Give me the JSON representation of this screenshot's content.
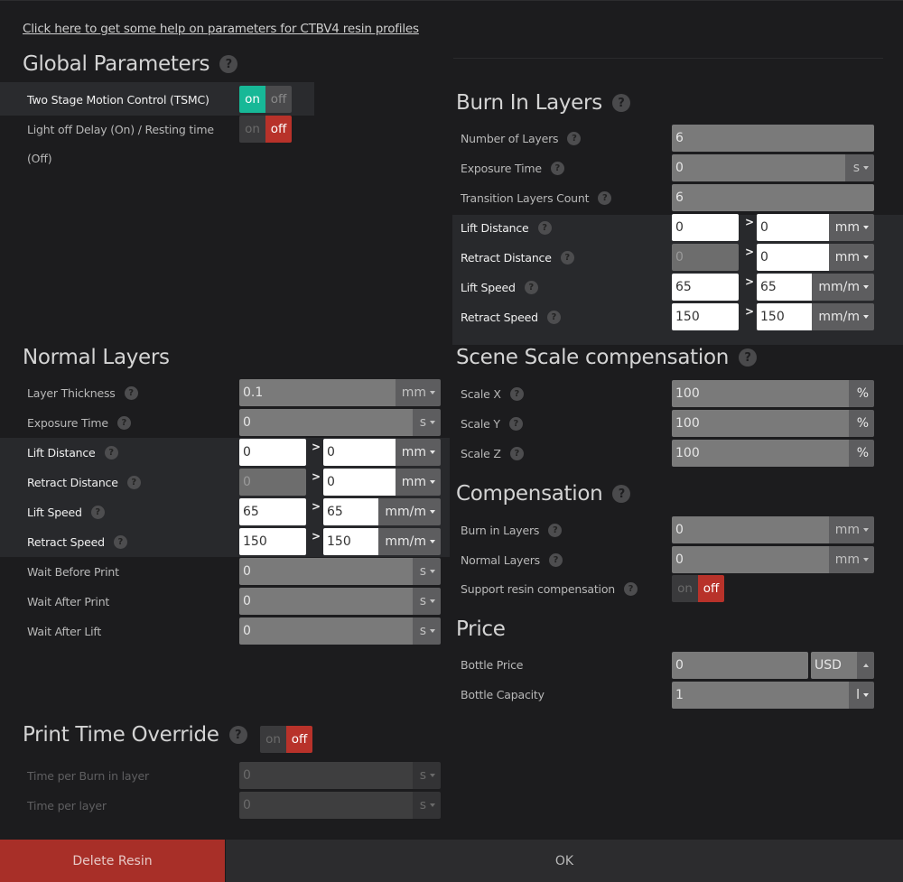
{
  "help_link": "Click here to get some help on parameters for CTBV4 resin profiles",
  "colors": {
    "accent_on": "#17b897",
    "accent_off": "#b8322a",
    "delete": "#a82f28"
  },
  "global": {
    "title": "Global Parameters",
    "tsmc_label": "Two Stage Motion Control (TSMC)",
    "tsmc_on": "on",
    "tsmc_off": "off",
    "light_off_label_1": "Light off Delay (On) / Resting time",
    "light_off_label_2": "(Off)",
    "light_on": "on",
    "light_off": "off"
  },
  "burn": {
    "title": "Burn In Layers",
    "num_layers_label": "Number of Layers",
    "num_layers": "6",
    "exposure_label": "Exposure Time",
    "exposure": "0",
    "exposure_unit": "s",
    "transition_label": "Transition Layers Count",
    "transition": "6",
    "lift_dist_label": "Lift Distance",
    "lift_dist_1": "0",
    "lift_dist_2": "0",
    "lift_dist_unit": "mm",
    "retract_dist_label": "Retract Distance",
    "retract_dist_1": "0",
    "retract_dist_2": "0",
    "retract_dist_unit": "mm",
    "lift_speed_label": "Lift Speed",
    "lift_speed_1": "65",
    "lift_speed_2": "65",
    "lift_speed_unit": "mm/m",
    "retract_speed_label": "Retract Speed",
    "retract_speed_1": "150",
    "retract_speed_2": "150",
    "retract_speed_unit": "mm/m",
    "gt": ">"
  },
  "normal": {
    "title": "Normal Layers",
    "layer_thickness_label": "Layer Thickness",
    "layer_thickness": "0.1",
    "layer_thickness_unit": "mm",
    "exposure_label": "Exposure Time",
    "exposure": "0",
    "exposure_unit": "s",
    "lift_dist_label": "Lift Distance",
    "lift_dist_1": "0",
    "lift_dist_2": "0",
    "lift_dist_unit": "mm",
    "retract_dist_label": "Retract Distance",
    "retract_dist_1": "0",
    "retract_dist_2": "0",
    "retract_dist_unit": "mm",
    "lift_speed_label": "Lift Speed",
    "lift_speed_1": "65",
    "lift_speed_2": "65",
    "lift_speed_unit": "mm/m",
    "retract_speed_label": "Retract Speed",
    "retract_speed_1": "150",
    "retract_speed_2": "150",
    "retract_speed_unit": "mm/m",
    "wait_before_label": "Wait Before Print",
    "wait_before": "0",
    "wait_before_unit": "s",
    "wait_after_label": "Wait After Print",
    "wait_after": "0",
    "wait_after_unit": "s",
    "wait_lift_label": "Wait After Lift",
    "wait_lift": "0",
    "wait_lift_unit": "s",
    "gt": ">"
  },
  "scale": {
    "title": "Scene Scale compensation",
    "x_label": "Scale X",
    "x": "100",
    "x_unit": "%",
    "y_label": "Scale Y",
    "y": "100",
    "y_unit": "%",
    "z_label": "Scale Z",
    "z": "100",
    "z_unit": "%"
  },
  "comp": {
    "title": "Compensation",
    "burn_label": "Burn in Layers",
    "burn": "0",
    "burn_unit": "mm",
    "normal_label": "Normal Layers",
    "normal": "0",
    "normal_unit": "mm",
    "support_label": "Support resin compensation",
    "support_on": "on",
    "support_off": "off"
  },
  "price": {
    "title": "Price",
    "bottle_price_label": "Bottle Price",
    "bottle_price": "0",
    "currency": "USD",
    "bottle_capacity_label": "Bottle Capacity",
    "bottle_capacity": "1",
    "bottle_capacity_unit": "l"
  },
  "override": {
    "title": "Print Time Override",
    "on": "on",
    "off": "off",
    "burn_label": "Time per Burn in layer",
    "burn": "0",
    "burn_unit": "s",
    "layer_label": "Time per layer",
    "layer": "0",
    "layer_unit": "s"
  },
  "footer": {
    "delete": "Delete Resin",
    "ok": "OK"
  },
  "help_glyph": "?"
}
